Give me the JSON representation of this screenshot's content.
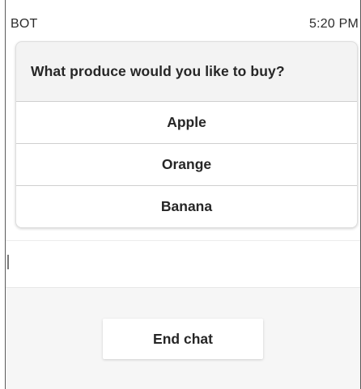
{
  "message": {
    "sender": "BOT",
    "time": "5:20 PM",
    "question": "What produce would you like to buy?",
    "options": [
      {
        "label": "Apple"
      },
      {
        "label": "Orange"
      },
      {
        "label": "Banana"
      }
    ]
  },
  "input": {
    "value": ""
  },
  "footer": {
    "end_chat_label": "End chat"
  }
}
